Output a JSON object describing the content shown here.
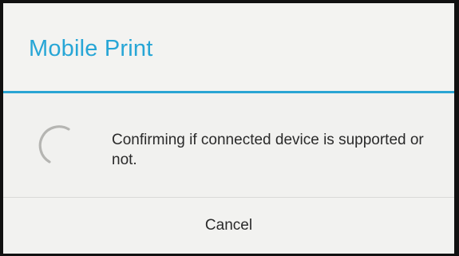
{
  "dialog": {
    "title": "Mobile Print",
    "message": "Confirming if connected device is supported or not.",
    "cancel_label": "Cancel",
    "spinner_icon": "loading-spinner-icon",
    "colors": {
      "accent": "#27a6d6",
      "background": "#f1f1ef",
      "text": "#2a2a2a",
      "spinner": "#b5b5b2"
    }
  }
}
